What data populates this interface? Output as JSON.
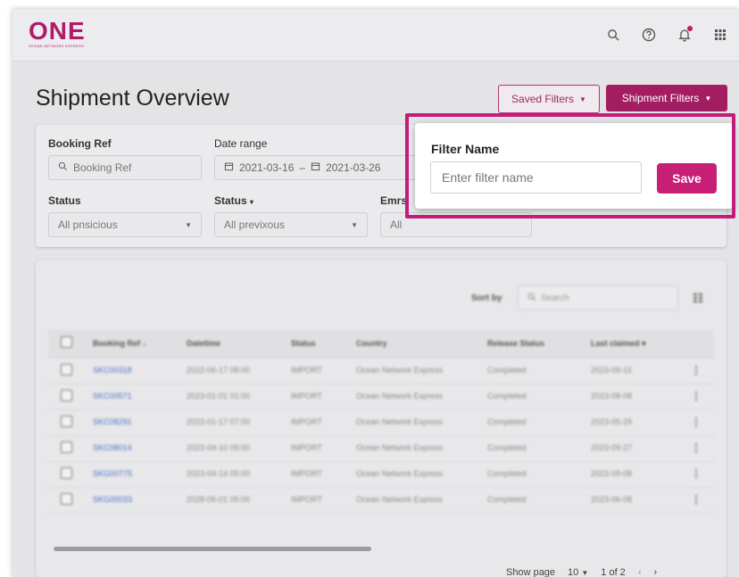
{
  "brand": {
    "logo_text": "ONE",
    "logo_tagline": "OCEAN NETWORK EXPRESS"
  },
  "header": {
    "icons": [
      "search-icon",
      "help-icon",
      "bell-icon",
      "apps-icon"
    ]
  },
  "page": {
    "title": "Shipment Overview"
  },
  "toolbar": {
    "saved_filters_label": "Saved Filters",
    "shipment_filters_label": "Shipment Filters"
  },
  "filters": {
    "booking_ref_label": "Booking Ref",
    "booking_ref_placeholder": "Booking Ref",
    "date_range_label": "Date range",
    "date_from": "2021-03-16",
    "date_sep": "–",
    "date_to": "2021-03-26",
    "status1_label": "Status",
    "status1_value": "All pnsicious",
    "status2_label": "Status",
    "status2_value": "All previxous",
    "status3_label": "Emrs",
    "status3_value": "All"
  },
  "popover": {
    "label": "Filter Name",
    "input_placeholder": "Enter filter name",
    "save_label": "Save"
  },
  "table": {
    "sort_by_label": "Sort by",
    "search_placeholder": "Search",
    "columns": [
      "Booking Ref",
      "Datetime",
      "Status",
      "Country",
      "Release Status",
      "Last claimed"
    ],
    "rows": [
      [
        "SKC00318",
        "2022-06-17 08:00",
        "IMPORT",
        "Ocean Network Express",
        "Completed",
        "2023-09-15"
      ],
      [
        "SKC00571",
        "2023-01-01 01:00",
        "IMPORT",
        "Ocean Network Express",
        "Completed",
        "2023-08-08"
      ],
      [
        "SKC08291",
        "2023-01-17 07:00",
        "IMPORT",
        "Ocean Network Express",
        "Completed",
        "2023-05-29"
      ],
      [
        "SKC08014",
        "2023-04-10 09:00",
        "IMPORT",
        "Ocean Network Express",
        "Completed",
        "2023-09-27"
      ],
      [
        "SKG00775",
        "2023-04-14 05:00",
        "IMPORT",
        "Ocean Network Express",
        "Completed",
        "2023-09-08"
      ],
      [
        "SKG00033",
        "2028-06-01 05:00",
        "IMPORT",
        "Ocean Network Express",
        "Completed",
        "2023-06-08"
      ]
    ]
  },
  "pagination": {
    "show_label": "Show page",
    "per_page": "10",
    "page_info": "1 of 2"
  }
}
